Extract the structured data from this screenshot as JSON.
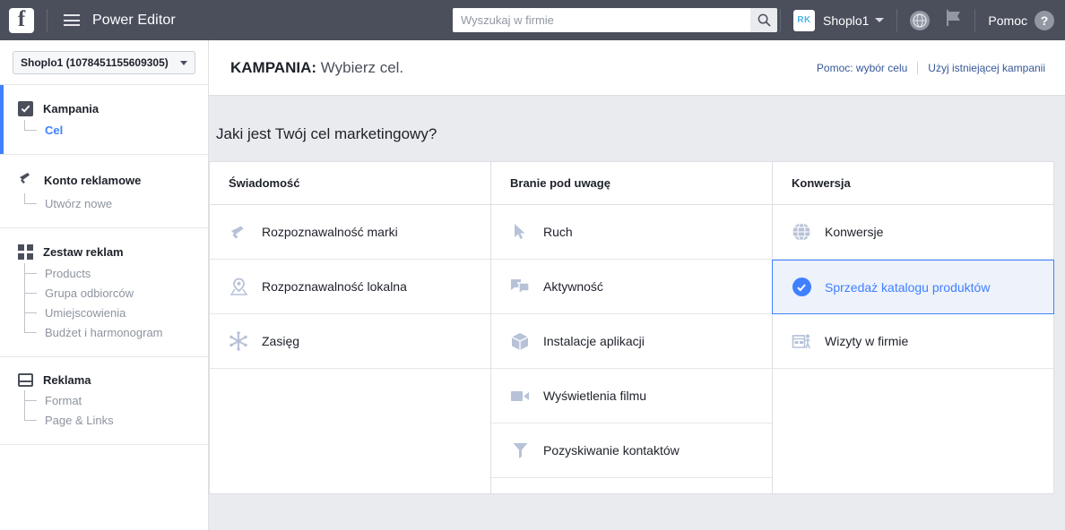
{
  "topbar": {
    "logo": "f",
    "menu_icon": "hamburger-icon",
    "app_title": "Power Editor",
    "search_placeholder": "Wyszukaj w firmie",
    "search_value": "",
    "search_icon": "search-icon",
    "avatar_initials": "RK",
    "account_name": "Shoplo1",
    "globe_icon": "globe-icon",
    "flag_icon": "flag-icon",
    "help_label": "Pomoc",
    "help_icon": "question-circle-icon"
  },
  "sidebar": {
    "account_select": "Shoplo1 (1078451155609305)",
    "sections": [
      {
        "label": "Kampania",
        "icon": "checkbox-checked-icon",
        "active": true,
        "children": [
          {
            "label": "Cel",
            "selected": true
          }
        ]
      },
      {
        "label": "Konto reklamowe",
        "icon": "megaphone-icon",
        "active": false,
        "children": [
          {
            "label": "Utwórz nowe",
            "selected": false
          }
        ]
      },
      {
        "label": "Zestaw reklam",
        "icon": "grid-icon",
        "active": false,
        "children": [
          {
            "label": "Products",
            "selected": false
          },
          {
            "label": "Grupa odbiorców",
            "selected": false
          },
          {
            "label": "Umiejscowienia",
            "selected": false
          },
          {
            "label": "Budżet i harmonogram",
            "selected": false
          }
        ]
      },
      {
        "label": "Reklama",
        "icon": "window-icon",
        "active": false,
        "children": [
          {
            "label": "Format",
            "selected": false
          },
          {
            "label": "Page & Links",
            "selected": false
          }
        ]
      }
    ]
  },
  "content": {
    "header_prefix": "KAMPANIA:",
    "header_title": " Wybierz cel.",
    "link_help": "Pomoc: wybór celu",
    "link_existing": "Użyj istniejącej kampanii",
    "question": "Jaki jest Twój cel marketingowy?",
    "columns": [
      {
        "header": "Świadomość",
        "items": [
          {
            "label": "Rozpoznawalność marki",
            "icon": "megaphone-icon",
            "selected": false
          },
          {
            "label": "Rozpoznawalność lokalna",
            "icon": "map-pin-icon",
            "selected": false
          },
          {
            "label": "Zasięg",
            "icon": "reach-asterisk-icon",
            "selected": false
          }
        ]
      },
      {
        "header": "Branie pod uwagę",
        "items": [
          {
            "label": "Ruch",
            "icon": "cursor-arrow-icon",
            "selected": false
          },
          {
            "label": "Aktywność",
            "icon": "speech-bubbles-icon",
            "selected": false
          },
          {
            "label": "Instalacje aplikacji",
            "icon": "box-icon",
            "selected": false
          },
          {
            "label": "Wyświetlenia filmu",
            "icon": "video-camera-icon",
            "selected": false
          },
          {
            "label": "Pozyskiwanie kontaktów",
            "icon": "funnel-icon",
            "selected": false
          }
        ]
      },
      {
        "header": "Konwersja",
        "items": [
          {
            "label": "Konwersje",
            "icon": "globe-icon",
            "selected": false
          },
          {
            "label": "Sprzedaż katalogu produktów",
            "icon": "check-circle-icon",
            "selected": true
          },
          {
            "label": "Wizyty w firmie",
            "icon": "storefront-icon",
            "selected": false
          }
        ]
      }
    ]
  },
  "colors": {
    "topbar_bg": "#4b4f5c",
    "accent_blue": "#4080ff",
    "link_blue": "#365899",
    "page_bg": "#e9ebee",
    "selected_row_bg": "#edf2fb"
  }
}
